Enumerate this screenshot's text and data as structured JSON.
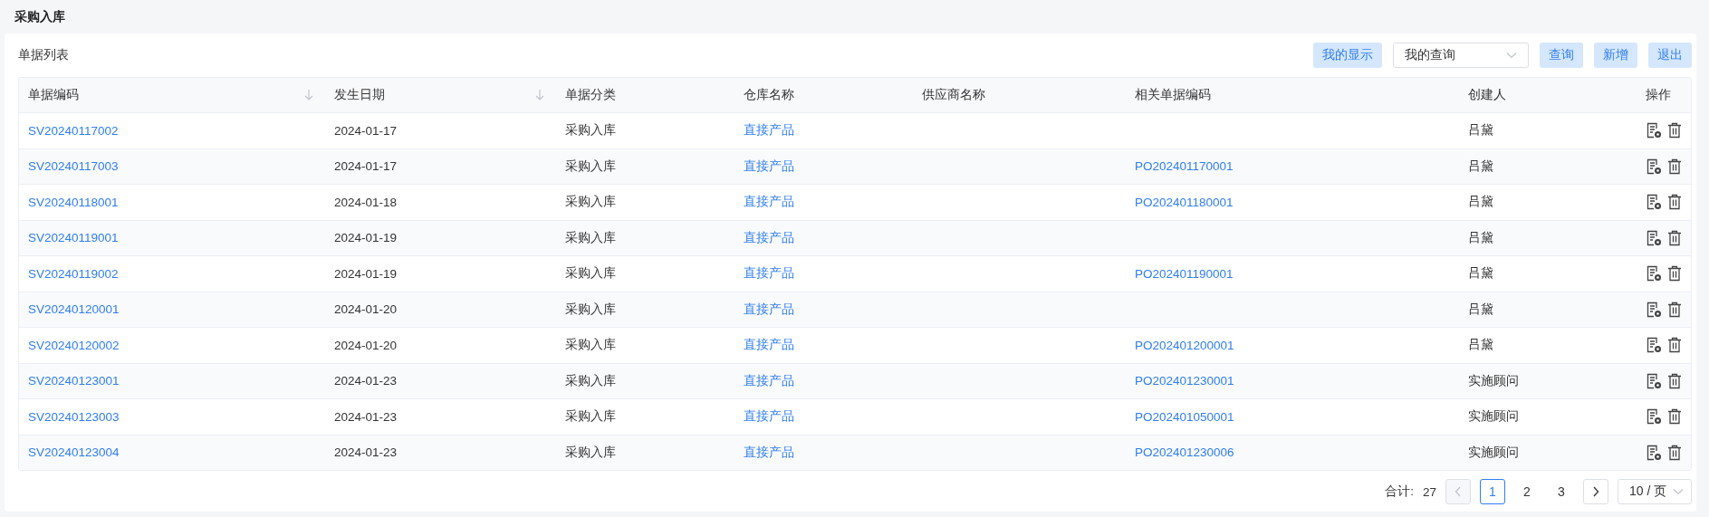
{
  "page_title": "采购入库",
  "section_title": "单据列表",
  "toolbar": {
    "display_button": "我的显示",
    "query_select": "我的查询",
    "buttons": [
      "查询",
      "新增",
      "退出"
    ]
  },
  "table": {
    "columns": [
      {
        "label": "单据编码",
        "sortable": true
      },
      {
        "label": "发生日期",
        "sortable": true
      },
      {
        "label": "单据分类",
        "sortable": false
      },
      {
        "label": "仓库名称",
        "sortable": false
      },
      {
        "label": "供应商名称",
        "sortable": false
      },
      {
        "label": "相关单据编码",
        "sortable": false
      },
      {
        "label": "创建人",
        "sortable": false
      },
      {
        "label": "操作",
        "sortable": false
      }
    ],
    "rows": [
      {
        "code": "SV20240117002",
        "date": "2024-01-17",
        "category": "采购入库",
        "warehouse": "直接产品",
        "related": "",
        "creator": "吕黛"
      },
      {
        "code": "SV20240117003",
        "date": "2024-01-17",
        "category": "采购入库",
        "warehouse": "直接产品",
        "related": "PO202401170001",
        "creator": "吕黛"
      },
      {
        "code": "SV20240118001",
        "date": "2024-01-18",
        "category": "采购入库",
        "warehouse": "直接产品",
        "related": "PO202401180001",
        "creator": "吕黛"
      },
      {
        "code": "SV20240119001",
        "date": "2024-01-19",
        "category": "采购入库",
        "warehouse": "直接产品",
        "related": "",
        "creator": "吕黛"
      },
      {
        "code": "SV20240119002",
        "date": "2024-01-19",
        "category": "采购入库",
        "warehouse": "直接产品",
        "related": "PO202401190001",
        "creator": "吕黛"
      },
      {
        "code": "SV20240120001",
        "date": "2024-01-20",
        "category": "采购入库",
        "warehouse": "直接产品",
        "related": "",
        "creator": "吕黛"
      },
      {
        "code": "SV20240120002",
        "date": "2024-01-20",
        "category": "采购入库",
        "warehouse": "直接产品",
        "related": "PO202401200001",
        "creator": "吕黛"
      },
      {
        "code": "SV20240123001",
        "date": "2024-01-23",
        "category": "采购入库",
        "warehouse": "直接产品",
        "related": "PO202401230001",
        "creator": "实施顾问"
      },
      {
        "code": "SV20240123003",
        "date": "2024-01-23",
        "category": "采购入库",
        "warehouse": "直接产品",
        "related": "PO202401050001",
        "creator": "实施顾问"
      },
      {
        "code": "SV20240123004",
        "date": "2024-01-23",
        "category": "采购入库",
        "warehouse": "直接产品",
        "related": "PO202401230006",
        "creator": "实施顾问"
      }
    ]
  },
  "pagination": {
    "total_label": "合计:",
    "total": "27",
    "prev_disabled": true,
    "next_disabled": false,
    "pages": [
      {
        "label": "1",
        "selected": true
      },
      {
        "label": "2",
        "selected": false
      },
      {
        "label": "3",
        "selected": false
      }
    ],
    "page_size": "10 / 页"
  }
}
